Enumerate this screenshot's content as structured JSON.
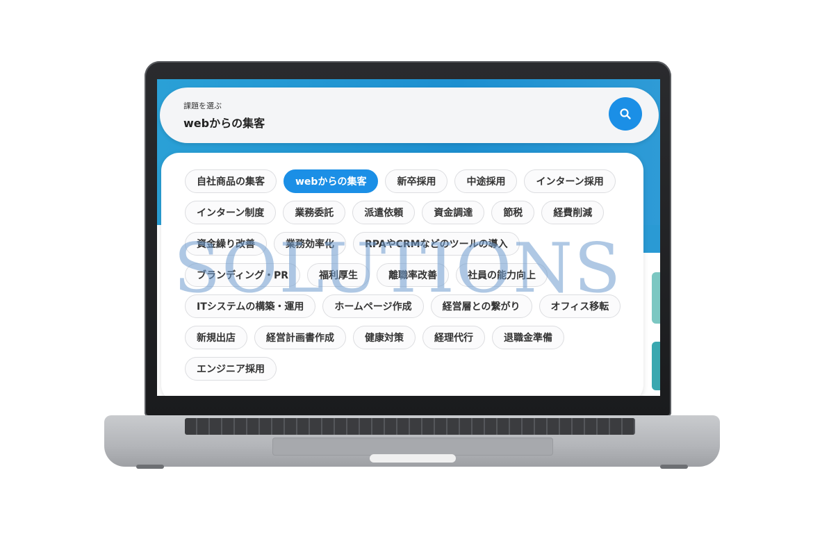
{
  "search": {
    "caption": "課題を選ぶ",
    "value": "webからの集客",
    "button_icon": "search-icon"
  },
  "chips": [
    {
      "label": "自社商品の集客",
      "active": false
    },
    {
      "label": "webからの集客",
      "active": true
    },
    {
      "label": "新卒採用",
      "active": false
    },
    {
      "label": "中途採用",
      "active": false
    },
    {
      "label": "インターン採用",
      "active": false
    },
    {
      "label": "インターン制度",
      "active": false
    },
    {
      "label": "業務委託",
      "active": false
    },
    {
      "label": "派遣依頼",
      "active": false
    },
    {
      "label": "資金調達",
      "active": false
    },
    {
      "label": "節税",
      "active": false
    },
    {
      "label": "経費削減",
      "active": false
    },
    {
      "label": "資金繰り改善",
      "active": false
    },
    {
      "label": "業務効率化",
      "active": false
    },
    {
      "label": "RPAやCRMなどのツールの導入",
      "active": false
    },
    {
      "label": "ブランディング・PR",
      "active": false
    },
    {
      "label": "福利厚生",
      "active": false
    },
    {
      "label": "離職率改善",
      "active": false
    },
    {
      "label": "社員の能力向上",
      "active": false
    },
    {
      "label": "ITシステムの構築・運用",
      "active": false
    },
    {
      "label": "ホームページ作成",
      "active": false
    },
    {
      "label": "経営層との繋がり",
      "active": false
    },
    {
      "label": "オフィス移転",
      "active": false
    },
    {
      "label": "新規出店",
      "active": false
    },
    {
      "label": "経営計画書作成",
      "active": false
    },
    {
      "label": "健康対策",
      "active": false
    },
    {
      "label": "経理代行",
      "active": false
    },
    {
      "label": "退職金準備",
      "active": false
    },
    {
      "label": "エンジニア採用",
      "active": false
    }
  ],
  "watermark": "SOLUTIONS",
  "colors": {
    "accent": "#1b8fe6",
    "hero": "#2aa0d6"
  }
}
